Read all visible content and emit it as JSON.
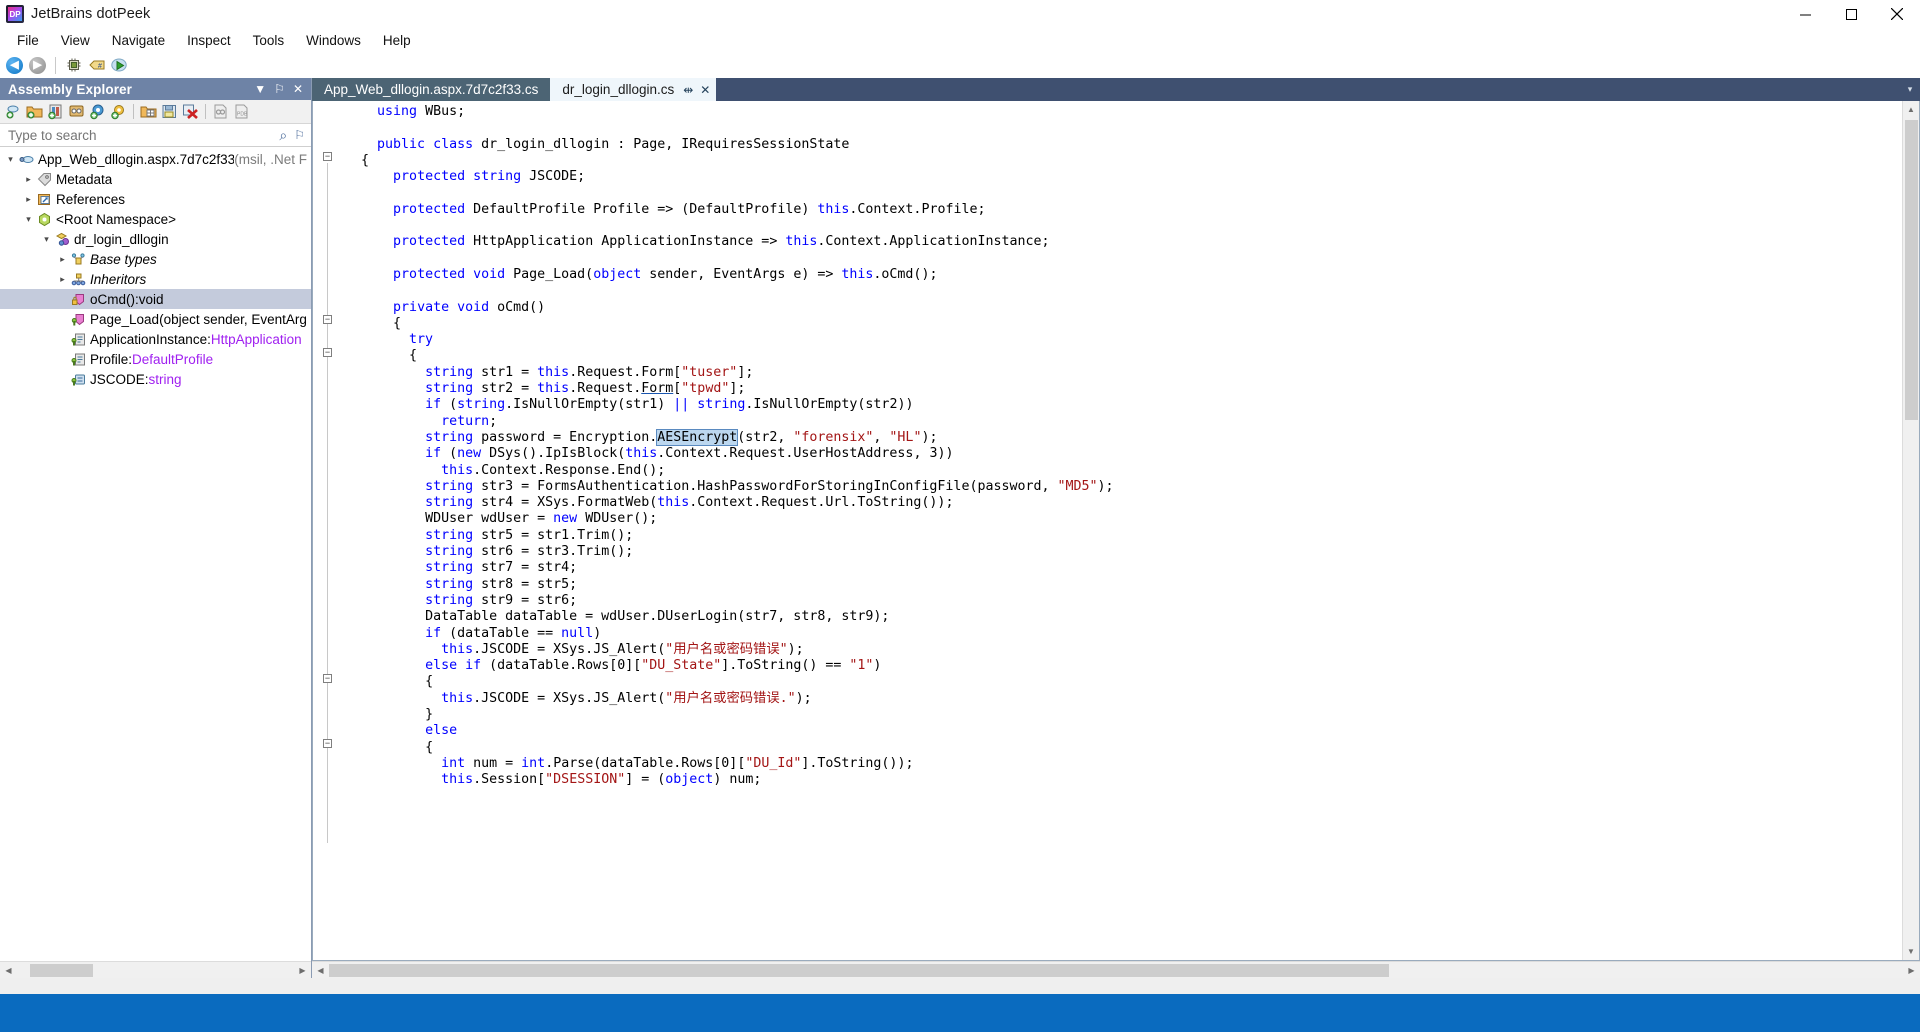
{
  "window": {
    "title": "JetBrains dotPeek",
    "app_icon": "dotpeek-logo-icon",
    "minimize_label": "Minimize",
    "maximize_label": "Maximize",
    "close_label": "Close"
  },
  "menubar": {
    "items": [
      {
        "label": "File"
      },
      {
        "label": "View"
      },
      {
        "label": "Navigate"
      },
      {
        "label": "Inspect"
      },
      {
        "label": "Tools"
      },
      {
        "label": "Windows"
      },
      {
        "label": "Help"
      }
    ]
  },
  "toolbar": {
    "items": [
      {
        "name": "back-button",
        "icon": "arrow-left-circle-icon",
        "glyph": "◀"
      },
      {
        "name": "forward-button",
        "icon": "arrow-right-circle-icon",
        "glyph": "▶"
      },
      {
        "name": "open-process-button",
        "icon": "process-chip-icon"
      },
      {
        "name": "assembly-list-button",
        "icon": "tag-hash-icon"
      },
      {
        "name": "run-button",
        "icon": "cloud-run-icon"
      }
    ]
  },
  "panel": {
    "title": "Assembly Explorer",
    "header_actions": [
      {
        "name": "panel-options-button",
        "icon": "chevron-down-icon",
        "glyph": "▼"
      },
      {
        "name": "panel-pin-button",
        "icon": "pin-icon",
        "glyph": "⚐"
      },
      {
        "name": "panel-close-button",
        "icon": "close-icon",
        "glyph": "✕"
      }
    ],
    "toolbar_buttons": [
      {
        "name": "open-from-gac-button",
        "icon": "open-gac-icon"
      },
      {
        "name": "open-folder-button",
        "icon": "open-folder-icon"
      },
      {
        "name": "add-assembly-button",
        "icon": "add-assembly-icon"
      },
      {
        "name": "open-process-modules-button",
        "icon": "process-modules-icon"
      },
      {
        "name": "add-nuget-button",
        "icon": "add-package-icon"
      },
      {
        "name": "options-button",
        "icon": "gear-icon"
      },
      {
        "name": "export-to-project-button",
        "icon": "export-project-icon"
      },
      {
        "name": "save-all-button",
        "icon": "save-all-icon"
      },
      {
        "name": "close-all-assemblies-button",
        "icon": "close-all-icon"
      },
      {
        "name": "load-symbols-button",
        "icon": "symbols-icon"
      },
      {
        "name": "pdb-button",
        "icon": "pdb-file-icon"
      }
    ],
    "search": {
      "placeholder": "Type to search",
      "value": "",
      "actions": [
        {
          "name": "search-options-button",
          "icon": "search-icon",
          "glyph": "⌕"
        },
        {
          "name": "search-pin-button",
          "icon": "pin-icon",
          "glyph": "⚐"
        }
      ]
    },
    "tree": [
      {
        "depth": 0,
        "twisty": "expanded",
        "icon": "assembly-icon",
        "label": "App_Web_dllogin.aspx.7d7c2f33",
        "suffix": " (msil, .Net F",
        "italic": false,
        "selected": false
      },
      {
        "depth": 1,
        "twisty": "collapsed",
        "icon": "metadata-tag-icon",
        "label": "Metadata",
        "suffix": "",
        "italic": false,
        "selected": false
      },
      {
        "depth": 1,
        "twisty": "collapsed",
        "icon": "references-icon",
        "label": "References",
        "suffix": "",
        "italic": false,
        "selected": false
      },
      {
        "depth": 1,
        "twisty": "expanded",
        "icon": "namespace-icon",
        "label": "<Root Namespace>",
        "suffix": "",
        "italic": false,
        "selected": false
      },
      {
        "depth": 2,
        "twisty": "expanded",
        "icon": "class-icon",
        "label": "dr_login_dllogin",
        "suffix": "",
        "italic": false,
        "selected": false
      },
      {
        "depth": 3,
        "twisty": "collapsed",
        "icon": "base-types-icon",
        "label": "Base types",
        "suffix": "",
        "italic": true,
        "selected": false
      },
      {
        "depth": 3,
        "twisty": "collapsed",
        "icon": "inheritors-icon",
        "label": "Inheritors",
        "suffix": "",
        "italic": true,
        "selected": false
      },
      {
        "depth": 3,
        "twisty": "none",
        "icon": "method-private-icon",
        "label": "oCmd():void",
        "suffix": "",
        "italic": false,
        "selected": true
      },
      {
        "depth": 3,
        "twisty": "none",
        "icon": "method-icon",
        "label": "Page_Load(object sender, EventArgs",
        "suffix": "",
        "italic": false,
        "selected": false
      },
      {
        "depth": 3,
        "twisty": "none",
        "icon": "property-icon",
        "label": "ApplicationInstance:",
        "type_text": "HttpApplication",
        "suffix": "",
        "italic": false,
        "selected": false
      },
      {
        "depth": 3,
        "twisty": "none",
        "icon": "property-icon",
        "label": "Profile:",
        "type_text": "DefaultProfile",
        "suffix": "",
        "italic": false,
        "selected": false
      },
      {
        "depth": 3,
        "twisty": "none",
        "icon": "field-icon",
        "label": "JSCODE:",
        "type_text": "string",
        "suffix": "",
        "italic": false,
        "selected": false
      }
    ]
  },
  "tabs": [
    {
      "label": "App_Web_dllogin.aspx.7d7c2f33.cs",
      "active": false,
      "closable": false
    },
    {
      "label": "dr_login_dllogin.cs",
      "active": true,
      "closable": true,
      "pin_glyph": "⇹",
      "close_glyph": "✕"
    }
  ],
  "editor": {
    "lines": [
      {
        "indent": 2,
        "tokens": [
          {
            "t": "using",
            "c": "kw"
          },
          {
            "t": " WBus;",
            "c": ""
          }
        ]
      },
      {
        "indent": 0,
        "tokens": []
      },
      {
        "indent": 2,
        "tokens": [
          {
            "t": "public class",
            "c": "kw"
          },
          {
            "t": " dr_login_dllogin : Page, IRequiresSessionState",
            "c": ""
          }
        ]
      },
      {
        "indent": 1,
        "tokens": [
          {
            "t": "{",
            "c": ""
          }
        ],
        "fold": "minus"
      },
      {
        "indent": 3,
        "tokens": [
          {
            "t": "protected string",
            "c": "kw"
          },
          {
            "t": " JSCODE;",
            "c": ""
          }
        ]
      },
      {
        "indent": 0,
        "tokens": []
      },
      {
        "indent": 3,
        "tokens": [
          {
            "t": "protected",
            "c": "kw"
          },
          {
            "t": " DefaultProfile Profile => (DefaultProfile) ",
            "c": ""
          },
          {
            "t": "this",
            "c": "kw"
          },
          {
            "t": ".Context.Profile;",
            "c": ""
          }
        ]
      },
      {
        "indent": 0,
        "tokens": []
      },
      {
        "indent": 3,
        "tokens": [
          {
            "t": "protected",
            "c": "kw"
          },
          {
            "t": " HttpApplication ApplicationInstance => ",
            "c": ""
          },
          {
            "t": "this",
            "c": "kw"
          },
          {
            "t": ".Context.ApplicationInstance;",
            "c": ""
          }
        ]
      },
      {
        "indent": 0,
        "tokens": []
      },
      {
        "indent": 3,
        "tokens": [
          {
            "t": "protected void",
            "c": "kw"
          },
          {
            "t": " Page_Load(",
            "c": ""
          },
          {
            "t": "object",
            "c": "kw"
          },
          {
            "t": " sender, EventArgs e) => ",
            "c": ""
          },
          {
            "t": "this",
            "c": "kw"
          },
          {
            "t": ".oCmd();",
            "c": ""
          }
        ]
      },
      {
        "indent": 0,
        "tokens": []
      },
      {
        "indent": 3,
        "tokens": [
          {
            "t": "private void",
            "c": "kw"
          },
          {
            "t": " oCmd()",
            "c": ""
          }
        ]
      },
      {
        "indent": 3,
        "tokens": [
          {
            "t": "{",
            "c": ""
          }
        ],
        "fold": "minus"
      },
      {
        "indent": 4,
        "tokens": [
          {
            "t": "try",
            "c": "kw"
          }
        ]
      },
      {
        "indent": 4,
        "tokens": [
          {
            "t": "{",
            "c": ""
          }
        ],
        "fold": "minus"
      },
      {
        "indent": 5,
        "tokens": [
          {
            "t": "string",
            "c": "kw"
          },
          {
            "t": " str1 = ",
            "c": ""
          },
          {
            "t": "this",
            "c": "kw"
          },
          {
            "t": ".Request.Form[",
            "c": ""
          },
          {
            "t": "\"tuser\"",
            "c": "str"
          },
          {
            "t": "];",
            "c": ""
          }
        ]
      },
      {
        "indent": 5,
        "tokens": [
          {
            "t": "string",
            "c": "kw"
          },
          {
            "t": " str2 = ",
            "c": ""
          },
          {
            "t": "this",
            "c": "kw"
          },
          {
            "t": ".Request.",
            "c": ""
          },
          {
            "t": "Form",
            "c": "ul"
          },
          {
            "t": "[",
            "c": ""
          },
          {
            "t": "\"tpwd\"",
            "c": "str"
          },
          {
            "t": "];",
            "c": ""
          }
        ]
      },
      {
        "indent": 5,
        "tokens": [
          {
            "t": "if",
            "c": "kw"
          },
          {
            "t": " (",
            "c": ""
          },
          {
            "t": "string",
            "c": "kw"
          },
          {
            "t": ".IsNullOrEmpty(str1) ",
            "c": ""
          },
          {
            "t": "||",
            "c": "kw"
          },
          {
            "t": " ",
            "c": ""
          },
          {
            "t": "string",
            "c": "kw"
          },
          {
            "t": ".IsNullOrEmpty(str2))",
            "c": ""
          }
        ]
      },
      {
        "indent": 6,
        "tokens": [
          {
            "t": "return",
            "c": "kw"
          },
          {
            "t": ";",
            "c": ""
          }
        ]
      },
      {
        "indent": 5,
        "tokens": [
          {
            "t": "string",
            "c": "kw"
          },
          {
            "t": " password = Encryption.",
            "c": ""
          },
          {
            "t": "AESEncrypt",
            "c": "hl"
          },
          {
            "t": "(str2, ",
            "c": ""
          },
          {
            "t": "\"forensix\"",
            "c": "str"
          },
          {
            "t": ", ",
            "c": ""
          },
          {
            "t": "\"HL\"",
            "c": "str"
          },
          {
            "t": ");",
            "c": ""
          }
        ]
      },
      {
        "indent": 5,
        "tokens": [
          {
            "t": "if",
            "c": "kw"
          },
          {
            "t": " (",
            "c": ""
          },
          {
            "t": "new",
            "c": "kw"
          },
          {
            "t": " DSys().IpIsBlock(",
            "c": ""
          },
          {
            "t": "this",
            "c": "kw"
          },
          {
            "t": ".Context.Request.UserHostAddress, 3))",
            "c": ""
          }
        ]
      },
      {
        "indent": 6,
        "tokens": [
          {
            "t": "this",
            "c": "kw"
          },
          {
            "t": ".Context.Response.End();",
            "c": ""
          }
        ]
      },
      {
        "indent": 5,
        "tokens": [
          {
            "t": "string",
            "c": "kw"
          },
          {
            "t": " str3 = FormsAuthentication.HashPasswordForStoringInConfigFile(password, ",
            "c": ""
          },
          {
            "t": "\"MD5\"",
            "c": "str"
          },
          {
            "t": ");",
            "c": ""
          }
        ]
      },
      {
        "indent": 5,
        "tokens": [
          {
            "t": "string",
            "c": "kw"
          },
          {
            "t": " str4 = XSys.FormatWeb(",
            "c": ""
          },
          {
            "t": "this",
            "c": "kw"
          },
          {
            "t": ".Context.Request.Url.ToString());",
            "c": ""
          }
        ]
      },
      {
        "indent": 5,
        "tokens": [
          {
            "t": "WDUser wdUser = ",
            "c": ""
          },
          {
            "t": "new",
            "c": "kw"
          },
          {
            "t": " WDUser();",
            "c": ""
          }
        ]
      },
      {
        "indent": 5,
        "tokens": [
          {
            "t": "string",
            "c": "kw"
          },
          {
            "t": " str5 = str1.Trim();",
            "c": ""
          }
        ]
      },
      {
        "indent": 5,
        "tokens": [
          {
            "t": "string",
            "c": "kw"
          },
          {
            "t": " str6 = str3.Trim();",
            "c": ""
          }
        ]
      },
      {
        "indent": 5,
        "tokens": [
          {
            "t": "string",
            "c": "kw"
          },
          {
            "t": " str7 = str4;",
            "c": ""
          }
        ]
      },
      {
        "indent": 5,
        "tokens": [
          {
            "t": "string",
            "c": "kw"
          },
          {
            "t": " str8 = str5;",
            "c": ""
          }
        ]
      },
      {
        "indent": 5,
        "tokens": [
          {
            "t": "string",
            "c": "kw"
          },
          {
            "t": " str9 = str6;",
            "c": ""
          }
        ]
      },
      {
        "indent": 5,
        "tokens": [
          {
            "t": "DataTable dataTable = wdUser.DUserLogin(str7, str8, str9);",
            "c": ""
          }
        ]
      },
      {
        "indent": 5,
        "tokens": [
          {
            "t": "if",
            "c": "kw"
          },
          {
            "t": " (dataTable == ",
            "c": ""
          },
          {
            "t": "null",
            "c": "kw"
          },
          {
            "t": ")",
            "c": ""
          }
        ]
      },
      {
        "indent": 6,
        "tokens": [
          {
            "t": "this",
            "c": "kw"
          },
          {
            "t": ".JSCODE = XSys.JS_Alert(",
            "c": ""
          },
          {
            "t": "\"用户名或密码错误\"",
            "c": "str"
          },
          {
            "t": ");",
            "c": ""
          }
        ]
      },
      {
        "indent": 5,
        "tokens": [
          {
            "t": "else if",
            "c": "kw"
          },
          {
            "t": " (dataTable.Rows[0][",
            "c": ""
          },
          {
            "t": "\"DU_State\"",
            "c": "str"
          },
          {
            "t": "].ToString() == ",
            "c": ""
          },
          {
            "t": "\"1\"",
            "c": "str"
          },
          {
            "t": ")",
            "c": ""
          }
        ]
      },
      {
        "indent": 5,
        "tokens": [
          {
            "t": "{",
            "c": ""
          }
        ],
        "fold": "minus"
      },
      {
        "indent": 6,
        "tokens": [
          {
            "t": "this",
            "c": "kw"
          },
          {
            "t": ".JSCODE = XSys.JS_Alert(",
            "c": ""
          },
          {
            "t": "\"用户名或密码错误.\"",
            "c": "str"
          },
          {
            "t": ");",
            "c": ""
          }
        ]
      },
      {
        "indent": 5,
        "tokens": [
          {
            "t": "}",
            "c": ""
          }
        ]
      },
      {
        "indent": 5,
        "tokens": [
          {
            "t": "else",
            "c": "kw"
          }
        ]
      },
      {
        "indent": 5,
        "tokens": [
          {
            "t": "{",
            "c": ""
          }
        ],
        "fold": "minus"
      },
      {
        "indent": 6,
        "tokens": [
          {
            "t": "int",
            "c": "kw"
          },
          {
            "t": " num = ",
            "c": ""
          },
          {
            "t": "int",
            "c": "kw"
          },
          {
            "t": ".Parse(dataTable.Rows[0][",
            "c": ""
          },
          {
            "t": "\"DU_Id\"",
            "c": "str"
          },
          {
            "t": "].ToString());",
            "c": ""
          }
        ]
      },
      {
        "indent": 6,
        "tokens": [
          {
            "t": "this",
            "c": "kw"
          },
          {
            "t": ".Session[",
            "c": ""
          },
          {
            "t": "\"DSESSION\"",
            "c": "str"
          },
          {
            "t": "] = (",
            "c": ""
          },
          {
            "t": "object",
            "c": "kw"
          },
          {
            "t": ") num;",
            "c": ""
          }
        ]
      }
    ],
    "scroll": {
      "up_glyph": "▲",
      "down_glyph": "▼",
      "left_glyph": "◀",
      "right_glyph": "▶"
    }
  },
  "colors": {
    "accent_blue": "#0a6bbf",
    "panel_header": "#6e83a6",
    "tab_active_bg": "#eff6fb",
    "tab_inactive_bg": "#4c6474",
    "tabstrip_bg": "#3f5070",
    "selection": "#c4cbdc",
    "keyword": "#0000ff",
    "string": "#a31515",
    "type_purple": "#a020f0",
    "highlight": "#bcd7ef"
  }
}
